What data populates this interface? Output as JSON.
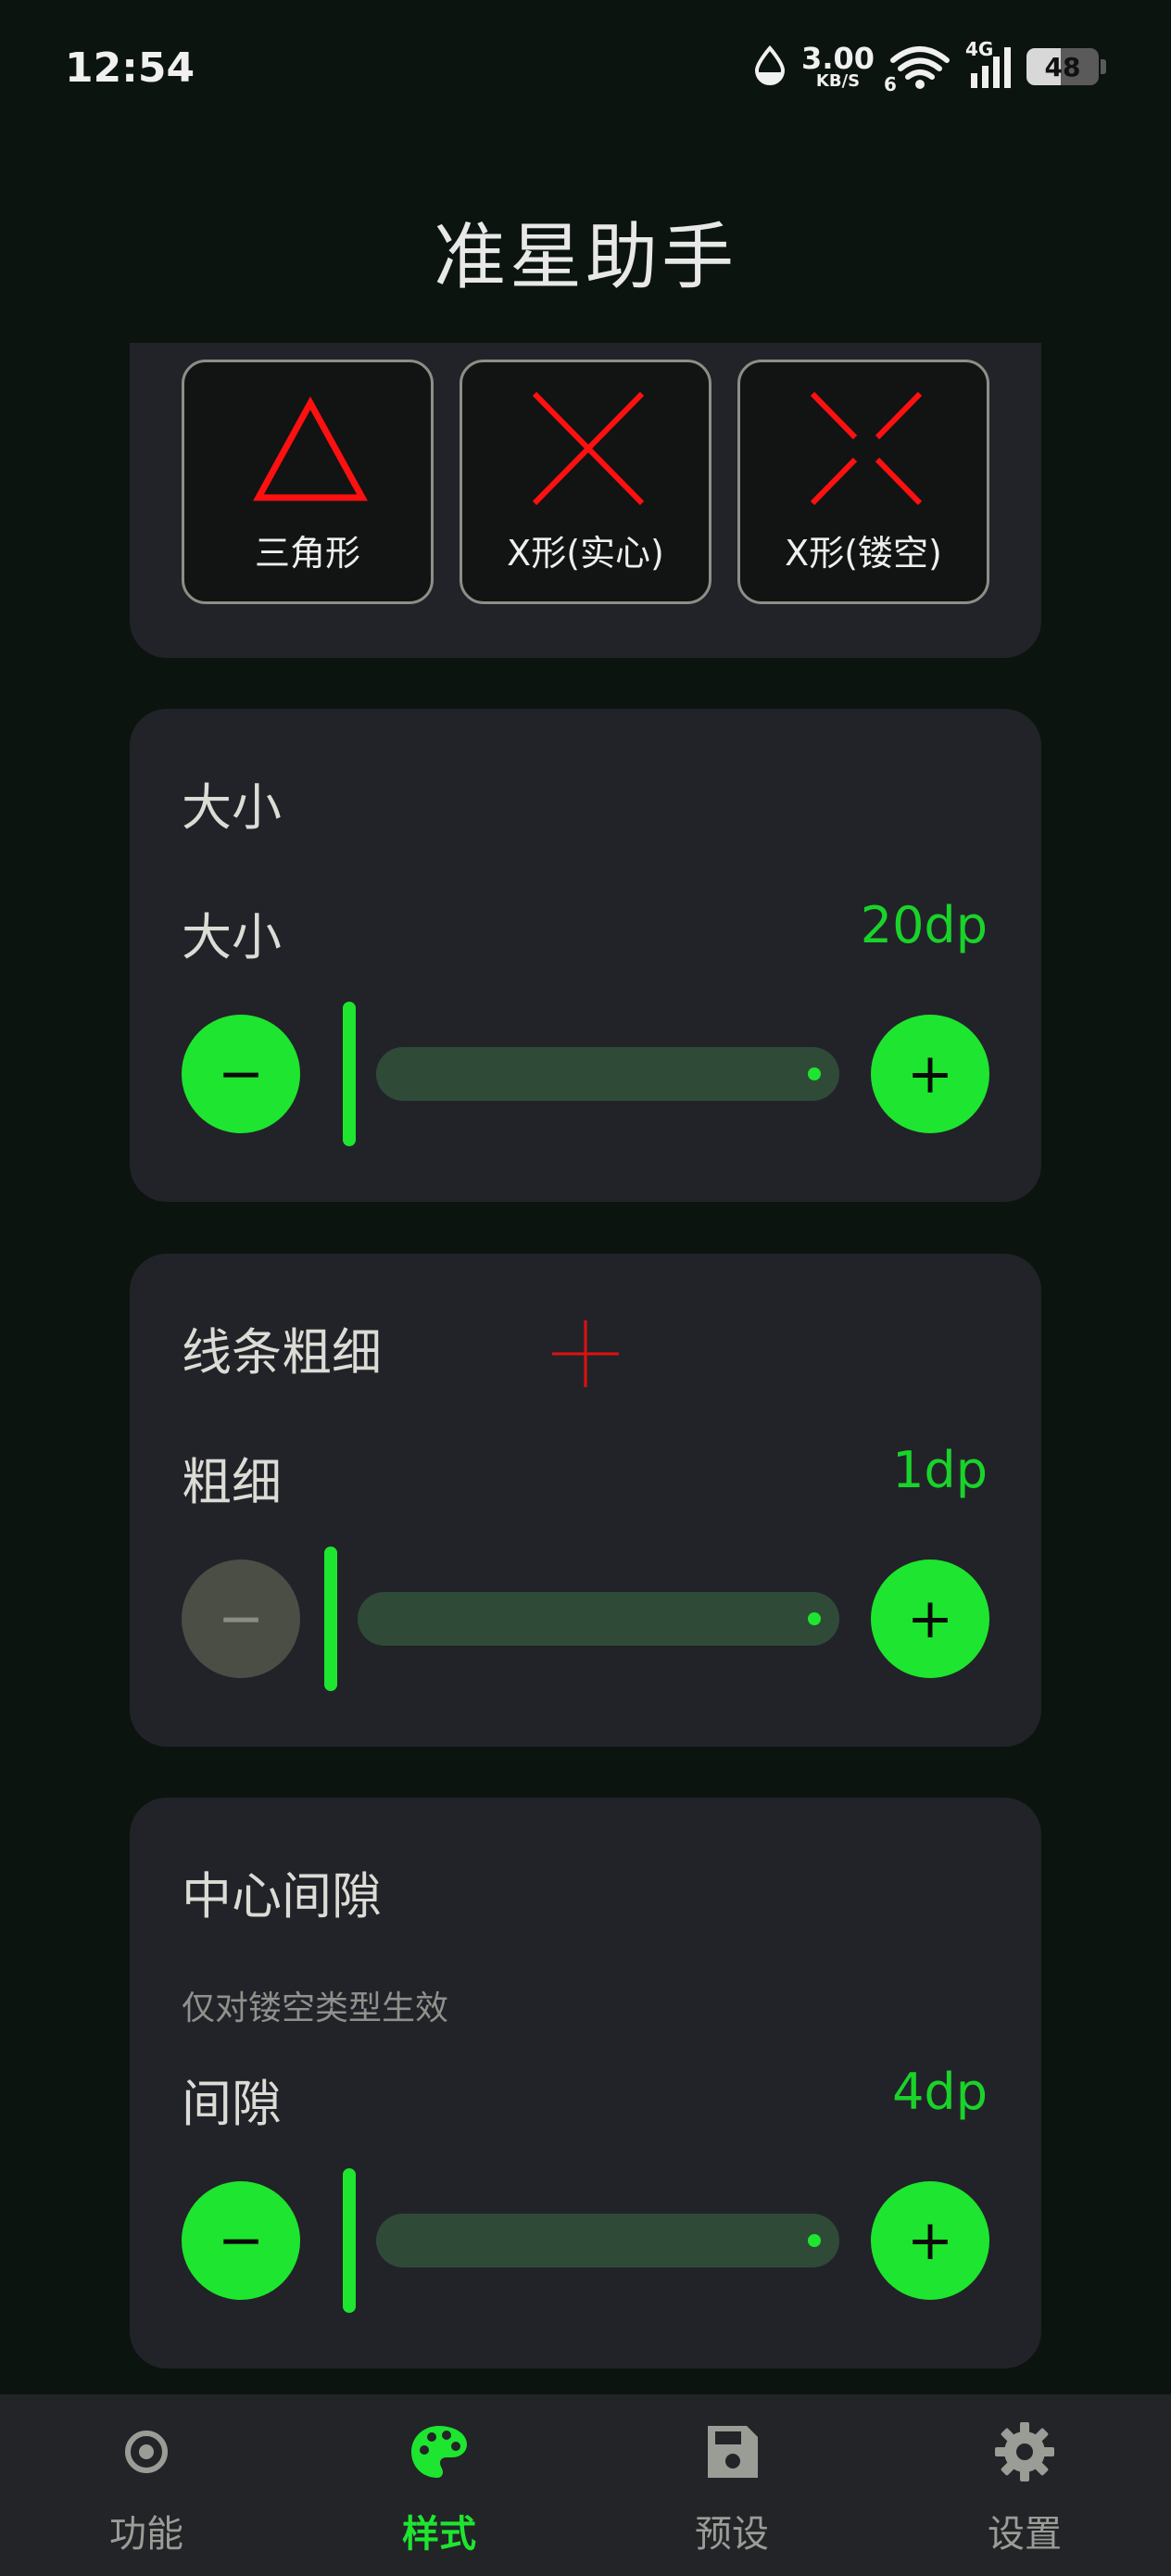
{
  "status_bar": {
    "time": "12:54",
    "net_speed_value": "3.00",
    "net_speed_unit": "KB/S",
    "signal_label": "4G",
    "wifi_sub": "6",
    "battery_level": "48"
  },
  "app": {
    "title": "准星助手"
  },
  "shapes": {
    "items": [
      {
        "label": "三角形",
        "icon": "triangle-icon"
      },
      {
        "label": "X形(实心)",
        "icon": "x-solid-icon"
      },
      {
        "label": "X形(镂空)",
        "icon": "x-hollow-icon"
      }
    ],
    "accent_color": "#ff0000"
  },
  "size_card": {
    "title": "大小",
    "row_label": "大小",
    "value": "20dp",
    "slider_fraction": 0.0
  },
  "line_card": {
    "title": "线条粗细",
    "row_label": "粗细",
    "value": "1dp",
    "slider_fraction": 0.0,
    "preview_icon": "crosshair-preview-icon"
  },
  "gap_card": {
    "title": "中心间隙",
    "hint": "仅对镂空类型生效",
    "row_label": "间隙",
    "value": "4dp",
    "slider_fraction": 0.0
  },
  "bottom_nav": {
    "items": [
      {
        "label": "功能",
        "icon": "target-icon",
        "active": false
      },
      {
        "label": "样式",
        "icon": "palette-icon",
        "active": true
      },
      {
        "label": "预设",
        "icon": "save-icon",
        "active": false
      },
      {
        "label": "设置",
        "icon": "gear-icon",
        "active": false
      }
    ]
  },
  "colors": {
    "accent": "#1ee52f",
    "value_text": "#19d32a",
    "background": "#0c140f",
    "card": "#222328",
    "track": "#2f4b37"
  }
}
